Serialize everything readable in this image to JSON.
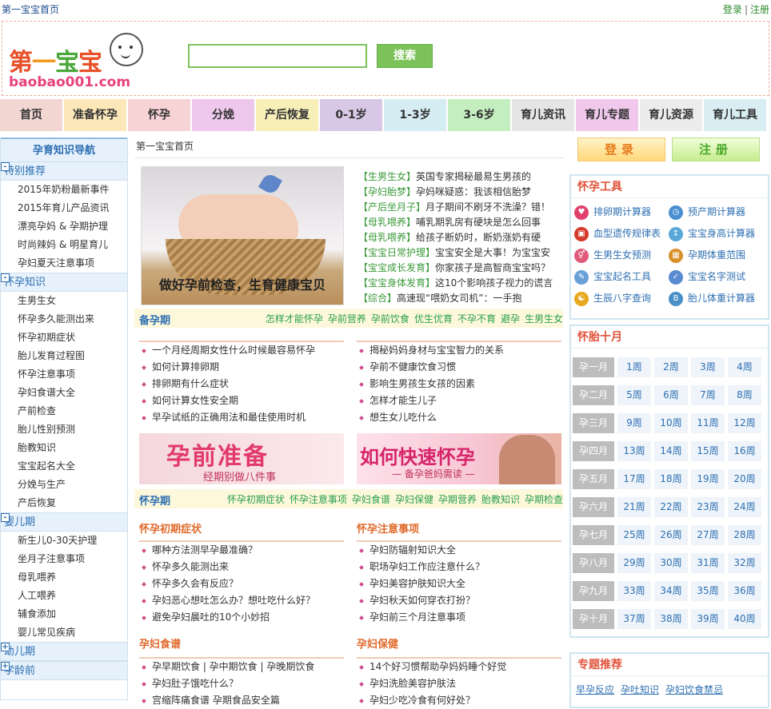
{
  "topbar": {
    "home": "第一宝宝首页",
    "login": "登录",
    "sep": "|",
    "register": "注册"
  },
  "logo": {
    "cn": [
      "第",
      "一",
      "宝",
      "宝"
    ],
    "en": "baobao001.com"
  },
  "search": {
    "button": "搜索",
    "value": ""
  },
  "nav": [
    {
      "label": "首页",
      "color": "#f1d6d2"
    },
    {
      "label": "准备怀孕",
      "color": "#fbe7b8"
    },
    {
      "label": "怀孕",
      "color": "#f8d3d6"
    },
    {
      "label": "分娩",
      "color": "#eec8ec"
    },
    {
      "label": "产后恢复",
      "color": "#f8efb8"
    },
    {
      "label": "0-1岁",
      "color": "#d8c8e6"
    },
    {
      "label": "1-3岁",
      "color": "#d4ecf2"
    },
    {
      "label": "3-6岁",
      "color": "#c4eec0"
    },
    {
      "label": "育儿资讯",
      "color": "#e5e5e5"
    },
    {
      "label": "育儿专题",
      "color": "#f0c8ec"
    },
    {
      "label": "育儿资源",
      "color": "#ececec"
    },
    {
      "label": "育儿工具",
      "color": "#d8eef2"
    }
  ],
  "sidebar": {
    "title": "孕育知识导航",
    "sections": [
      {
        "title": "特别推荐",
        "mark": "-",
        "links": [
          "2015年奶粉最新事件",
          "2015年育儿产品资讯",
          "漂亮孕妈 & 孕期护理",
          "时尚辣妈 & 明星育儿",
          "孕妇夏天注意事项"
        ]
      },
      {
        "title": "怀孕知识",
        "mark": "-",
        "links": [
          "生男生女",
          "怀孕多久能测出来",
          "怀孕初期症状",
          "胎儿发育过程图",
          "怀孕注意事项",
          "孕妇食谱大全",
          "产前检查",
          "胎儿性别预测",
          "胎教知识",
          "宝宝起名大全",
          "分娩与生产",
          "产后恢复"
        ]
      },
      {
        "title": "婴儿期",
        "mark": "-",
        "links": [
          "新生儿0-30天护理",
          "坐月子注意事项",
          "母乳喂养",
          "人工喂养",
          "辅食添加",
          "婴儿常见疾病"
        ]
      },
      {
        "title": "幼儿期",
        "mark": "+",
        "links": []
      },
      {
        "title": "学龄前",
        "mark": "+",
        "links": []
      }
    ]
  },
  "center": {
    "breadcrumb": "第一宝宝首页",
    "photo_caption": "做好孕前检查，生育健康宝贝",
    "headlines": [
      {
        "tag": "【生男生女】",
        "text": "英国专家揭秘最易生男孩的"
      },
      {
        "tag": "【孕妇胎梦】",
        "text": "孕妈咪疑惑：我该相信胎梦"
      },
      {
        "tag": "【产后坐月子】",
        "text": "月子期间不刷牙不洗澡？错！"
      },
      {
        "tag": "【母乳喂养】",
        "text": "哺乳期乳房有硬块是怎么回事"
      },
      {
        "tag": "【母乳喂养】",
        "text": "给孩子断奶时，断奶涨奶有硬"
      },
      {
        "tag": "【宝宝日常护理】",
        "text": "宝宝安全是大事！为宝宝安"
      },
      {
        "tag": "【宝宝成长发育】",
        "text": "你家孩子是高智商宝宝吗？"
      },
      {
        "tag": "【宝宝身体发育】",
        "text": "这10个影响孩子视力的谎言"
      },
      {
        "tag": "【综合】",
        "text": "高速现“喂奶女司机”：一手抱"
      }
    ],
    "sec1": {
      "name": "备孕期",
      "links": [
        "怎样才能怀孕",
        "孕前营养",
        "孕前饮食",
        "优生优育",
        "不孕不育",
        "避孕",
        "生男生女"
      ],
      "list_left": [
        "一个月经周期女性什么时候最容易怀孕",
        "如何计算排卵期",
        "排卵期有什么症状",
        "如何计算女性安全期",
        "早孕试纸的正确用法和最佳使用时机"
      ],
      "list_right": [
        "揭秘妈妈身材与宝宝智力的关系",
        "孕前不健康饮食习惯",
        "影响生男孩生女孩的因素",
        "怎样才能生儿子",
        "想生女儿吃什么"
      ],
      "banner1_big": "孕前准备",
      "banner1_small": "经期别做八件事",
      "banner2_big": "如何快速怀孕",
      "banner2_small": "— 备孕爸妈需读 —"
    },
    "sec2": {
      "name": "怀孕期",
      "links": [
        "怀孕初期症状",
        "怀孕注意事项",
        "孕妇食谱",
        "孕妇保健",
        "孕期营养",
        "胎教知识",
        "孕期检查"
      ],
      "sub1_title": "怀孕初期症状",
      "sub1": [
        "哪种方法测早孕最准确？",
        "怀孕多久能测出来",
        "怀孕多久会有反应？",
        "孕妇恶心想吐怎么办？想吐吃什么好？",
        "避免孕妇晨吐的10个小妙招"
      ],
      "sub2_title": "怀孕注意事项",
      "sub2": [
        "孕妇防辐射知识大全",
        "职场孕妇工作应注意什么？",
        "孕妇美容护肤知识大全",
        "孕妇秋天如何穿衣打扮？",
        "孕妇前三个月注意事项"
      ],
      "sub3_title": "孕妇食谱",
      "sub3": [
        "孕早期饮食 | 孕中期饮食 | 孕晚期饮食",
        "孕妇肚子饿吃什么？",
        "宫缩阵痛食谱 孕期食品安全篇"
      ],
      "sub4_title": "孕妇保健",
      "sub4": [
        "14个好习惯帮助孕妈妈睡个好觉",
        "孕妇洗脸美容护肤法",
        "孕妇少吃冷食有何好处？"
      ]
    }
  },
  "right": {
    "login": "登录",
    "register": "注册",
    "tools_title": "怀孕工具",
    "tools": [
      {
        "label": "排卵期计算器",
        "icon": "heart-icon",
        "color": "#e0406a",
        "glyph": "♥"
      },
      {
        "label": "预产期计算器",
        "icon": "clock-icon",
        "color": "#4a8fd0",
        "glyph": "◷"
      },
      {
        "label": "血型遗传规律表",
        "icon": "gift-icon",
        "color": "#d63a2a",
        "glyph": "▣"
      },
      {
        "label": "宝宝身高计算器",
        "icon": "height-icon",
        "color": "#5aa8d8",
        "glyph": "↕"
      },
      {
        "label": "生男生女预测",
        "icon": "gender-icon",
        "color": "#e05a7a",
        "glyph": "⚥"
      },
      {
        "label": "孕期体重范围",
        "icon": "scale-icon",
        "color": "#d8902a",
        "glyph": "▦"
      },
      {
        "label": "宝宝起名工具",
        "icon": "name-icon",
        "color": "#6aa0d8",
        "glyph": "✎"
      },
      {
        "label": "宝宝名字测试",
        "icon": "test-icon",
        "color": "#5a8ad0",
        "glyph": "✓"
      },
      {
        "label": "生辰八字查询",
        "icon": "yinyang-icon",
        "color": "#e8a820",
        "glyph": "☯"
      },
      {
        "label": "胎儿体重计算器",
        "icon": "bmi-icon",
        "color": "#4a90c8",
        "glyph": "B"
      }
    ],
    "months_title": "怀胎十月",
    "months": [
      {
        "m": "孕一月",
        "w": [
          "1周",
          "2周",
          "3周",
          "4周"
        ]
      },
      {
        "m": "孕二月",
        "w": [
          "5周",
          "6周",
          "7周",
          "8周"
        ]
      },
      {
        "m": "孕三月",
        "w": [
          "9周",
          "10周",
          "11周",
          "12周"
        ]
      },
      {
        "m": "孕四月",
        "w": [
          "13周",
          "14周",
          "15周",
          "16周"
        ]
      },
      {
        "m": "孕五月",
        "w": [
          "17周",
          "18周",
          "19周",
          "20周"
        ]
      },
      {
        "m": "孕六月",
        "w": [
          "21周",
          "22周",
          "23周",
          "24周"
        ]
      },
      {
        "m": "孕七月",
        "w": [
          "25周",
          "26周",
          "27周",
          "28周"
        ]
      },
      {
        "m": "孕八月",
        "w": [
          "29周",
          "30周",
          "31周",
          "32周"
        ]
      },
      {
        "m": "孕九月",
        "w": [
          "33周",
          "34周",
          "35周",
          "36周"
        ]
      },
      {
        "m": "孕十月",
        "w": [
          "37周",
          "38周",
          "39周",
          "40周"
        ]
      }
    ],
    "topics_title": "专题推荐",
    "topics": [
      "早孕反应",
      "孕吐知识",
      "孕妇饮食禁忌"
    ]
  }
}
